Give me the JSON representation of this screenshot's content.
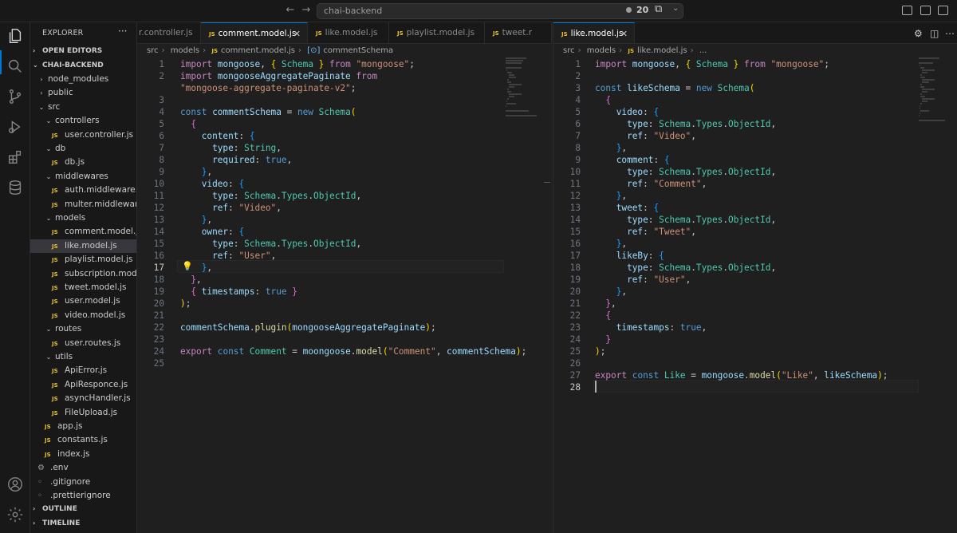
{
  "window": {
    "title": "chai-backend",
    "notification_count": "20"
  },
  "activity_bar": {
    "items": [
      "explorer-icon",
      "search-icon",
      "source-control-icon",
      "run-debug-icon",
      "extensions-icon",
      "database-icon"
    ],
    "bottom": [
      "account-icon",
      "settings-gear-icon"
    ]
  },
  "sidebar": {
    "header": "EXPLORER",
    "more": "···",
    "open_editors": "OPEN EDITORS",
    "project": "CHAI-BACKEND",
    "tree": [
      {
        "label": "node_modules",
        "kind": "folder",
        "open": false,
        "depth": 1
      },
      {
        "label": "public",
        "kind": "folder",
        "open": false,
        "depth": 1
      },
      {
        "label": "src",
        "kind": "folder",
        "open": true,
        "depth": 1
      },
      {
        "label": "controllers",
        "kind": "folder",
        "open": true,
        "depth": 2
      },
      {
        "label": "user.controller.js",
        "kind": "js",
        "depth": 3
      },
      {
        "label": "db",
        "kind": "folder",
        "open": true,
        "depth": 2
      },
      {
        "label": "db.js",
        "kind": "js",
        "depth": 3
      },
      {
        "label": "middlewares",
        "kind": "folder",
        "open": true,
        "depth": 2
      },
      {
        "label": "auth.middleware.js",
        "kind": "js",
        "depth": 3
      },
      {
        "label": "multer.middleware.js",
        "kind": "js",
        "depth": 3
      },
      {
        "label": "models",
        "kind": "folder",
        "open": true,
        "depth": 2
      },
      {
        "label": "comment.model.js",
        "kind": "js",
        "depth": 3
      },
      {
        "label": "like.model.js",
        "kind": "js",
        "depth": 3,
        "selected": true
      },
      {
        "label": "playlist.model.js",
        "kind": "js",
        "depth": 3
      },
      {
        "label": "subscription.model.js",
        "kind": "js",
        "depth": 3
      },
      {
        "label": "tweet.model.js",
        "kind": "js",
        "depth": 3
      },
      {
        "label": "user.model.js",
        "kind": "js",
        "depth": 3
      },
      {
        "label": "video.model.js",
        "kind": "js",
        "depth": 3
      },
      {
        "label": "routes",
        "kind": "folder",
        "open": true,
        "depth": 2
      },
      {
        "label": "user.routes.js",
        "kind": "js",
        "depth": 3
      },
      {
        "label": "utils",
        "kind": "folder",
        "open": true,
        "depth": 2
      },
      {
        "label": "ApiError.js",
        "kind": "js",
        "depth": 3
      },
      {
        "label": "ApiResponce.js",
        "kind": "js",
        "depth": 3
      },
      {
        "label": "asyncHandler.js",
        "kind": "js",
        "depth": 3
      },
      {
        "label": "FileUpload.js",
        "kind": "js",
        "depth": 3
      },
      {
        "label": "app.js",
        "kind": "js",
        "depth": 2
      },
      {
        "label": "constants.js",
        "kind": "js",
        "depth": 2
      },
      {
        "label": "index.js",
        "kind": "js",
        "depth": 2
      },
      {
        "label": ".env",
        "kind": "gear",
        "depth": 1
      },
      {
        "label": ".gitignore",
        "kind": "dot",
        "depth": 1
      },
      {
        "label": ".prettierignore",
        "kind": "dot",
        "depth": 1
      }
    ],
    "outline": "OUTLINE",
    "timeline": "TIMELINE"
  },
  "left_editor": {
    "tabs": [
      {
        "label": "r.controller.js",
        "active": false
      },
      {
        "label": "comment.model.js",
        "active": true
      },
      {
        "label": "like.model.js",
        "active": false
      },
      {
        "label": "playlist.model.js",
        "active": false
      },
      {
        "label": "tweet.r",
        "active": false
      }
    ],
    "breadcrumb": [
      "src",
      "models",
      "comment.model.js",
      "commentSchema"
    ],
    "current_line": "17",
    "lines": [
      [
        [
          "c",
          "import "
        ],
        [
          "v",
          "mongoose"
        ],
        [
          "p",
          ", "
        ],
        [
          "b1",
          "{ "
        ],
        [
          "t",
          "Schema"
        ],
        [
          "b1",
          " }"
        ],
        [
          "c",
          " from "
        ],
        [
          "s",
          "\"mongoose\""
        ],
        [
          "p",
          ";"
        ]
      ],
      [
        [
          "c",
          "import "
        ],
        [
          "v",
          "mongooseAggregatePaginate"
        ],
        [
          "c",
          " from"
        ]
      ],
      [
        [
          "s",
          "\"mongoose-aggregate-paginate-v2\""
        ],
        [
          "p",
          ";"
        ]
      ],
      [],
      [
        [
          "k",
          "const "
        ],
        [
          "v",
          "commentSchema"
        ],
        [
          "p",
          " = "
        ],
        [
          "k",
          "new "
        ],
        [
          "t",
          "Schema"
        ],
        [
          "b1",
          "("
        ]
      ],
      [
        [
          "p",
          "  "
        ],
        [
          "b2",
          "{"
        ]
      ],
      [
        [
          "p",
          "    "
        ],
        [
          "v",
          "content"
        ],
        [
          "p",
          ": "
        ],
        [
          "b3",
          "{"
        ]
      ],
      [
        [
          "p",
          "      "
        ],
        [
          "v",
          "type"
        ],
        [
          "p",
          ": "
        ],
        [
          "t",
          "String"
        ],
        [
          "p",
          ","
        ]
      ],
      [
        [
          "p",
          "      "
        ],
        [
          "v",
          "required"
        ],
        [
          "p",
          ": "
        ],
        [
          "k",
          "true"
        ],
        [
          "p",
          ","
        ]
      ],
      [
        [
          "p",
          "    "
        ],
        [
          "b3",
          "}"
        ],
        [
          "p",
          ","
        ]
      ],
      [
        [
          "p",
          "    "
        ],
        [
          "v",
          "video"
        ],
        [
          "p",
          ": "
        ],
        [
          "b3",
          "{"
        ]
      ],
      [
        [
          "p",
          "      "
        ],
        [
          "v",
          "type"
        ],
        [
          "p",
          ": "
        ],
        [
          "t",
          "Schema"
        ],
        [
          "p",
          "."
        ],
        [
          "t",
          "Types"
        ],
        [
          "p",
          "."
        ],
        [
          "t",
          "ObjectId"
        ],
        [
          "p",
          ","
        ]
      ],
      [
        [
          "p",
          "      "
        ],
        [
          "v",
          "ref"
        ],
        [
          "p",
          ": "
        ],
        [
          "s",
          "\"Video\""
        ],
        [
          "p",
          ","
        ]
      ],
      [
        [
          "p",
          "    "
        ],
        [
          "b3",
          "}"
        ],
        [
          "p",
          ","
        ]
      ],
      [
        [
          "p",
          "    "
        ],
        [
          "v",
          "owner"
        ],
        [
          "p",
          ": "
        ],
        [
          "b3",
          "{"
        ]
      ],
      [
        [
          "p",
          "      "
        ],
        [
          "v",
          "type"
        ],
        [
          "p",
          ": "
        ],
        [
          "t",
          "Schema"
        ],
        [
          "p",
          "."
        ],
        [
          "t",
          "Types"
        ],
        [
          "p",
          "."
        ],
        [
          "t",
          "ObjectId"
        ],
        [
          "p",
          ","
        ]
      ],
      [
        [
          "p",
          "      "
        ],
        [
          "v",
          "ref"
        ],
        [
          "p",
          ": "
        ],
        [
          "s",
          "\"User\""
        ],
        [
          "p",
          ","
        ]
      ],
      [
        [
          "p",
          "    "
        ],
        [
          "b3",
          "}"
        ],
        [
          "p",
          ","
        ]
      ],
      [
        [
          "p",
          "  "
        ],
        [
          "b2",
          "}"
        ],
        [
          "p",
          ","
        ]
      ],
      [
        [
          "p",
          "  "
        ],
        [
          "b2",
          "{ "
        ],
        [
          "v",
          "timestamps"
        ],
        [
          "p",
          ": "
        ],
        [
          "k",
          "true"
        ],
        [
          "b2",
          " }"
        ]
      ],
      [
        [
          "b1",
          ")"
        ],
        [
          "p",
          ";"
        ]
      ],
      [],
      [
        [
          "v",
          "commentSchema"
        ],
        [
          "p",
          "."
        ],
        [
          "f",
          "plugin"
        ],
        [
          "b1",
          "("
        ],
        [
          "v",
          "mongooseAggregatePaginate"
        ],
        [
          "b1",
          ")"
        ],
        [
          "p",
          ";"
        ]
      ],
      [],
      [
        [
          "c",
          "export "
        ],
        [
          "k",
          "const "
        ],
        [
          "t",
          "Comment"
        ],
        [
          "p",
          " = "
        ],
        [
          "v",
          "moongoose"
        ],
        [
          "p",
          "."
        ],
        [
          "f",
          "model"
        ],
        [
          "b1",
          "("
        ],
        [
          "s",
          "\"Comment\""
        ],
        [
          "p",
          ", "
        ],
        [
          "v",
          "commentSchema"
        ],
        [
          "b1",
          ")"
        ],
        [
          "p",
          ";"
        ]
      ],
      []
    ],
    "line_numbers": [
      "1",
      "2",
      "",
      "3",
      "4",
      "5",
      "6",
      "7",
      "8",
      "9",
      "10",
      "11",
      "12",
      "13",
      "14",
      "15",
      "16",
      "17",
      "18",
      "19",
      "20",
      "21",
      "22",
      "23",
      "24",
      "25"
    ]
  },
  "right_editor": {
    "tabs": [
      {
        "label": "like.model.js",
        "active": true
      }
    ],
    "breadcrumb": [
      "src",
      "models",
      "like.model.js",
      "..."
    ],
    "current_line": "28",
    "lines": [
      [
        [
          "c",
          "import "
        ],
        [
          "v",
          "mongoose"
        ],
        [
          "p",
          ", "
        ],
        [
          "b1",
          "{ "
        ],
        [
          "t",
          "Schema"
        ],
        [
          "b1",
          " }"
        ],
        [
          "c",
          " from "
        ],
        [
          "s",
          "\"mongoose\""
        ],
        [
          "p",
          ";"
        ]
      ],
      [],
      [
        [
          "k",
          "const "
        ],
        [
          "v",
          "likeSchema"
        ],
        [
          "p",
          " = "
        ],
        [
          "k",
          "new "
        ],
        [
          "t",
          "Schema"
        ],
        [
          "b1",
          "("
        ]
      ],
      [
        [
          "p",
          "  "
        ],
        [
          "b2",
          "{"
        ]
      ],
      [
        [
          "p",
          "    "
        ],
        [
          "v",
          "video"
        ],
        [
          "p",
          ": "
        ],
        [
          "b3",
          "{"
        ]
      ],
      [
        [
          "p",
          "      "
        ],
        [
          "v",
          "type"
        ],
        [
          "p",
          ": "
        ],
        [
          "t",
          "Schema"
        ],
        [
          "p",
          "."
        ],
        [
          "t",
          "Types"
        ],
        [
          "p",
          "."
        ],
        [
          "t",
          "ObjectId"
        ],
        [
          "p",
          ","
        ]
      ],
      [
        [
          "p",
          "      "
        ],
        [
          "v",
          "ref"
        ],
        [
          "p",
          ": "
        ],
        [
          "s",
          "\"Video\""
        ],
        [
          "p",
          ","
        ]
      ],
      [
        [
          "p",
          "    "
        ],
        [
          "b3",
          "}"
        ],
        [
          "p",
          ","
        ]
      ],
      [
        [
          "p",
          "    "
        ],
        [
          "v",
          "comment"
        ],
        [
          "p",
          ": "
        ],
        [
          "b3",
          "{"
        ]
      ],
      [
        [
          "p",
          "      "
        ],
        [
          "v",
          "type"
        ],
        [
          "p",
          ": "
        ],
        [
          "t",
          "Schema"
        ],
        [
          "p",
          "."
        ],
        [
          "t",
          "Types"
        ],
        [
          "p",
          "."
        ],
        [
          "t",
          "ObjectId"
        ],
        [
          "p",
          ","
        ]
      ],
      [
        [
          "p",
          "      "
        ],
        [
          "v",
          "ref"
        ],
        [
          "p",
          ": "
        ],
        [
          "s",
          "\"Comment\""
        ],
        [
          "p",
          ","
        ]
      ],
      [
        [
          "p",
          "    "
        ],
        [
          "b3",
          "}"
        ],
        [
          "p",
          ","
        ]
      ],
      [
        [
          "p",
          "    "
        ],
        [
          "v",
          "tweet"
        ],
        [
          "p",
          ": "
        ],
        [
          "b3",
          "{"
        ]
      ],
      [
        [
          "p",
          "      "
        ],
        [
          "v",
          "type"
        ],
        [
          "p",
          ": "
        ],
        [
          "t",
          "Schema"
        ],
        [
          "p",
          "."
        ],
        [
          "t",
          "Types"
        ],
        [
          "p",
          "."
        ],
        [
          "t",
          "ObjectId"
        ],
        [
          "p",
          ","
        ]
      ],
      [
        [
          "p",
          "      "
        ],
        [
          "v",
          "ref"
        ],
        [
          "p",
          ": "
        ],
        [
          "s",
          "\"Tweet\""
        ],
        [
          "p",
          ","
        ]
      ],
      [
        [
          "p",
          "    "
        ],
        [
          "b3",
          "}"
        ],
        [
          "p",
          ","
        ]
      ],
      [
        [
          "p",
          "    "
        ],
        [
          "v",
          "likeBy"
        ],
        [
          "p",
          ": "
        ],
        [
          "b3",
          "{"
        ]
      ],
      [
        [
          "p",
          "      "
        ],
        [
          "v",
          "type"
        ],
        [
          "p",
          ": "
        ],
        [
          "t",
          "Schema"
        ],
        [
          "p",
          "."
        ],
        [
          "t",
          "Types"
        ],
        [
          "p",
          "."
        ],
        [
          "t",
          "ObjectId"
        ],
        [
          "p",
          ","
        ]
      ],
      [
        [
          "p",
          "      "
        ],
        [
          "v",
          "ref"
        ],
        [
          "p",
          ": "
        ],
        [
          "s",
          "\"User\""
        ],
        [
          "p",
          ","
        ]
      ],
      [
        [
          "p",
          "    "
        ],
        [
          "b3",
          "}"
        ],
        [
          "p",
          ","
        ]
      ],
      [
        [
          "p",
          "  "
        ],
        [
          "b2",
          "}"
        ],
        [
          "p",
          ","
        ]
      ],
      [
        [
          "p",
          "  "
        ],
        [
          "b2",
          "{"
        ]
      ],
      [
        [
          "p",
          "    "
        ],
        [
          "v",
          "timestamps"
        ],
        [
          "p",
          ": "
        ],
        [
          "k",
          "true"
        ],
        [
          "p",
          ","
        ]
      ],
      [
        [
          "p",
          "  "
        ],
        [
          "b2",
          "}"
        ]
      ],
      [
        [
          "b1",
          ")"
        ],
        [
          "p",
          ";"
        ]
      ],
      [],
      [
        [
          "c",
          "export "
        ],
        [
          "k",
          "const "
        ],
        [
          "t",
          "Like"
        ],
        [
          "p",
          " = "
        ],
        [
          "v",
          "mongoose"
        ],
        [
          "p",
          "."
        ],
        [
          "f",
          "model"
        ],
        [
          "b1",
          "("
        ],
        [
          "s",
          "\"Like\""
        ],
        [
          "p",
          ", "
        ],
        [
          "v",
          "likeSchema"
        ],
        [
          "b1",
          ")"
        ],
        [
          "p",
          ";"
        ]
      ],
      []
    ],
    "line_numbers": [
      "1",
      "2",
      "3",
      "4",
      "5",
      "6",
      "7",
      "8",
      "9",
      "10",
      "11",
      "12",
      "13",
      "14",
      "15",
      "16",
      "17",
      "18",
      "19",
      "20",
      "21",
      "22",
      "23",
      "24",
      "25",
      "26",
      "27",
      "28"
    ]
  }
}
